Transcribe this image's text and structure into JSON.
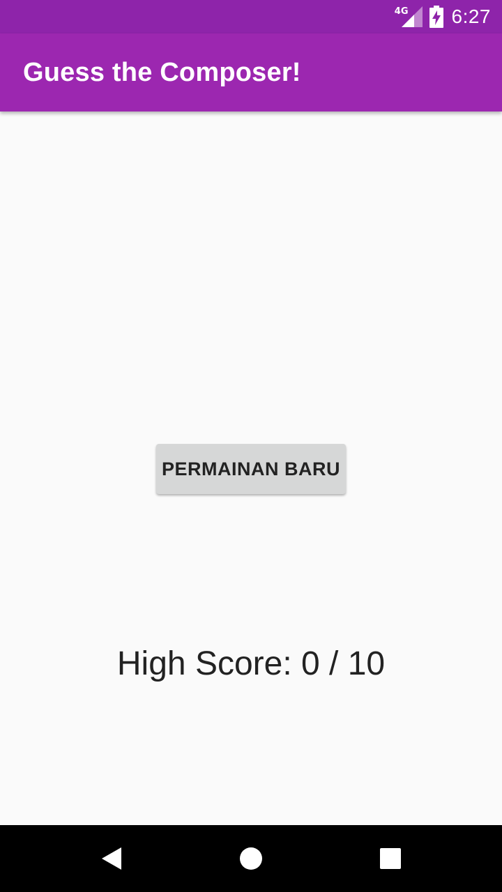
{
  "status_bar": {
    "network": "4G",
    "time": "6:27",
    "icons": [
      "signal-icon",
      "battery-charging-icon"
    ]
  },
  "app_bar": {
    "title": "Guess the Composer!"
  },
  "main": {
    "new_game_label": "PERMAINAN BARU",
    "high_score": "High Score: 0 / 10"
  },
  "nav_bar": {
    "icons": [
      "back-icon",
      "home-icon",
      "recents-icon"
    ]
  },
  "colors": {
    "status_bar": "#8e24aa",
    "app_bar": "#9c27b0",
    "background": "#fafafa",
    "button": "#d6d7d7",
    "text": "#222222",
    "nav_bar": "#000000"
  }
}
